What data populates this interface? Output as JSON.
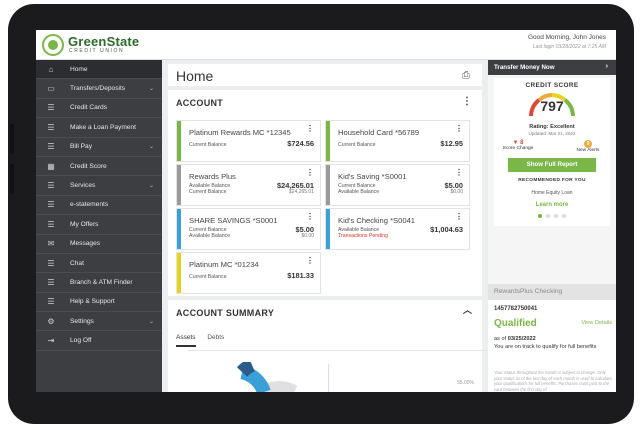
{
  "brand": {
    "name": "GreenState",
    "sub": "CREDIT UNION",
    "accent": "#7ab648"
  },
  "header": {
    "greeting": "Good Morning, John Jones",
    "last_login": "Last login 03/28/2022 at 7:25 AM"
  },
  "sidebar": {
    "items": [
      {
        "label": "Home",
        "icon": "home-icon",
        "glyph": "⌂",
        "chevron": false
      },
      {
        "label": "Transfers/Deposits",
        "icon": "card-icon",
        "glyph": "▭",
        "chevron": true
      },
      {
        "label": "Credit Cards",
        "icon": "menu-icon",
        "glyph": "☰",
        "chevron": false
      },
      {
        "label": "Make a Loan Payment",
        "icon": "menu-icon",
        "glyph": "☰",
        "chevron": false
      },
      {
        "label": "Bill Pay",
        "icon": "menu-icon",
        "glyph": "☰",
        "chevron": true
      },
      {
        "label": "Credit Score",
        "icon": "chart-icon",
        "glyph": "▦",
        "chevron": false
      },
      {
        "label": "Services",
        "icon": "menu-icon",
        "glyph": "☰",
        "chevron": true
      },
      {
        "label": "e-statements",
        "icon": "menu-icon",
        "glyph": "☰",
        "chevron": false
      },
      {
        "label": "My Offers",
        "icon": "menu-icon",
        "glyph": "☰",
        "chevron": false
      },
      {
        "label": "Messages",
        "icon": "mail-icon",
        "glyph": "✉",
        "chevron": false
      },
      {
        "label": "Chat",
        "icon": "menu-icon",
        "glyph": "☰",
        "chevron": false
      },
      {
        "label": "Branch & ATM Finder",
        "icon": "menu-icon",
        "glyph": "☰",
        "chevron": false
      },
      {
        "label": "Help & Support",
        "icon": "menu-icon",
        "glyph": "☰",
        "chevron": false
      },
      {
        "label": "Settings",
        "icon": "gear-icon",
        "glyph": "⚙",
        "chevron": true
      },
      {
        "label": "Log Off",
        "icon": "logout-icon",
        "glyph": "⇥",
        "chevron": false
      }
    ]
  },
  "main": {
    "title": "Home",
    "account": {
      "heading": "ACCOUNT",
      "cards": [
        {
          "name": "Platinum Rewards MC *12345",
          "label1": "Current Balance",
          "value": "$724.56",
          "label2": "",
          "sub": "",
          "color": "#7ab648"
        },
        {
          "name": "Household Card *56789",
          "label1": "Current Balance",
          "value": "$12.95",
          "label2": "",
          "sub": "",
          "color": "#7ab648"
        },
        {
          "name": "Rewards Plus",
          "label1": "Available Balance",
          "value": "$24,265.01",
          "label2": "Current Balance",
          "sub": "$24,265.01",
          "color": "#9a9a9a"
        },
        {
          "name": "Kid's Saving *S0001",
          "label1": "Current Balance",
          "value": "$5.00",
          "label2": "Available Balance",
          "sub": "$0.00",
          "color": "#9a9a9a"
        },
        {
          "name": "SHARE SAVINGS *S0001",
          "label1": "Current Balance",
          "value": "$5.00",
          "label2": "Available Balance",
          "sub": "$0.00",
          "color": "#3aa0d8"
        },
        {
          "name": "Kid's Checking *S0041",
          "label1": "Available Balance",
          "value": "$1,004.63",
          "label2": "Transactions Pending",
          "sub": "",
          "color": "#3aa0d8"
        },
        {
          "name": "Platinum MC *01234",
          "label1": "Current Balance",
          "value": "$181.33",
          "label2": "",
          "sub": "",
          "color": "#e8d21c"
        }
      ]
    },
    "summary": {
      "heading": "ACCOUNT SUMMARY",
      "tabs": [
        "Assets",
        "Debts"
      ],
      "partial_value": "55.00%"
    }
  },
  "right": {
    "transfer": "Transfer Money Now",
    "credit": {
      "title": "CREDIT SCORE",
      "score": "797",
      "rating": "Rating: Excellent",
      "updated": "Updated: Mar 21, 2022",
      "change_value": "▼ 8",
      "change_label": "Score Change",
      "alerts_value": "9",
      "alerts_label": "New Alerts",
      "report_button": "Show Full Report",
      "recommended": "RECOMMENDED FOR YOU",
      "rec_item": "Home Equity Loan",
      "learn": "Learn more"
    },
    "rewards": {
      "header": "RewardsPlus Checking",
      "account": "1457782750041",
      "status": "Qualified",
      "view": "View Details",
      "asof_label": "as of",
      "asof_date": "03/25/2022",
      "track": "You are on track to qualify for full benefits",
      "fine": "Your Status throughout the month is subject to change. Only your status as of the last day of each month is used to calculate your qualifications for full benefits. Purchases must post to the card between the first day of"
    }
  }
}
